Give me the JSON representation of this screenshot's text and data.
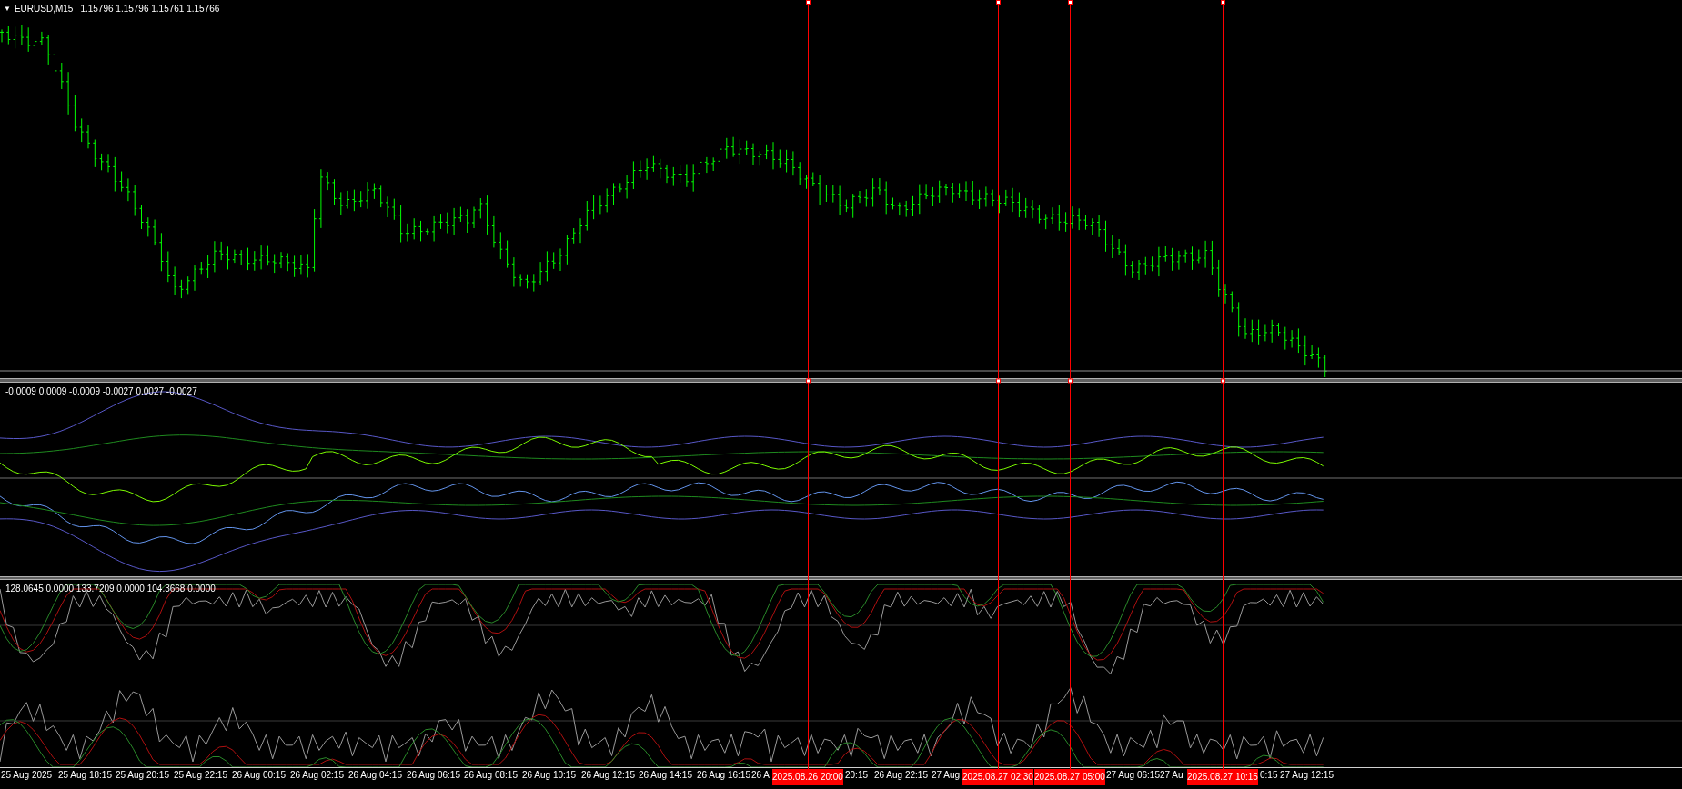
{
  "main_pane": {
    "symbol": "EURUSD,M15",
    "prices": "1.15796 1.15796 1.15761 1.15766",
    "collapse_icon": "▼"
  },
  "indicator_pane_1": {
    "values": "-0.0009 0.0009 -0.0009 -0.0027 0.0027 -0.0027"
  },
  "indicator_pane_2": {
    "values": "128.0645 0.0000 133.7209 0.0000 104.3668 0.0000"
  },
  "time_axis": [
    {
      "text": "25 Aug 2025"
    },
    {
      "text": "25 Aug 18:15"
    },
    {
      "text": "25 Aug 20:15"
    },
    {
      "text": "25 Aug 22:15"
    },
    {
      "text": "26 Aug 00:15"
    },
    {
      "text": "26 Aug 02:15"
    },
    {
      "text": "26 Aug 04:15"
    },
    {
      "text": "26 Aug 06:15"
    },
    {
      "text": "26 Aug 08:15"
    },
    {
      "text": "26 Aug 10:15"
    },
    {
      "text": "26 Aug 12:15"
    },
    {
      "text": "26 Aug 14:15"
    },
    {
      "text": "26 Aug 16:15"
    },
    {
      "text": "26 A"
    },
    {
      "text": "20:15"
    },
    {
      "text": "26 Aug 22:15"
    },
    {
      "text": "27 Aug"
    },
    {
      "text": "27 Aug 06:15"
    },
    {
      "text": "27 Au"
    },
    {
      "text": "0:15"
    },
    {
      "text": "27 Aug 12:15"
    }
  ],
  "vertical_lines": [
    {
      "label": "2025.08.26 20:00",
      "color": "#ff0000"
    },
    {
      "label": "2025.08.27 02:30",
      "color": "#ff0000"
    },
    {
      "label": "2025.08.27 05:00",
      "color": "#ff0000"
    },
    {
      "label": "2025.08.27 10:15",
      "color": "#ff0000"
    }
  ]
}
